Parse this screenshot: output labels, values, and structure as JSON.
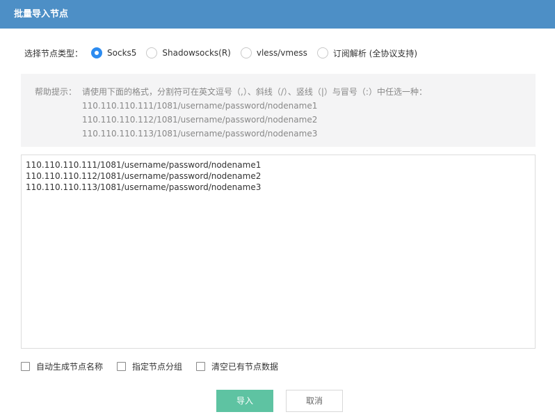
{
  "dialog": {
    "title": "批量导入节点"
  },
  "node_type": {
    "label": "选择节点类型：",
    "options": [
      {
        "label": "Socks5",
        "checked": true
      },
      {
        "label": "Shadowsocks(R)",
        "checked": false
      },
      {
        "label": "vless/vmess",
        "checked": false
      },
      {
        "label": "订阅解析 (全协议支持)",
        "checked": false
      }
    ]
  },
  "help": {
    "label": "帮助提示：",
    "lines": [
      "请使用下面的格式，分割符可在英文逗号（,）、斜线（/）、竖线（|）与冒号（:）中任选一种：",
      "110.110.110.111/1081/username/password/nodename1",
      "110.110.110.112/1081/username/password/nodename2",
      "110.110.110.113/1081/username/password/nodename3"
    ]
  },
  "input": {
    "value": "110.110.110.111/1081/username/password/nodename1\n110.110.110.112/1081/username/password/nodename2\n110.110.110.113/1081/username/password/nodename3"
  },
  "options": [
    {
      "label": "自动生成节点名称",
      "checked": false
    },
    {
      "label": "指定节点分组",
      "checked": false
    },
    {
      "label": "清空已有节点数据",
      "checked": false
    }
  ],
  "buttons": {
    "import": "导入",
    "cancel": "取消"
  },
  "colors": {
    "titlebar": "#4d8fc6",
    "radio_checked": "#2d8cf0",
    "primary_button": "#5ec3a2"
  }
}
